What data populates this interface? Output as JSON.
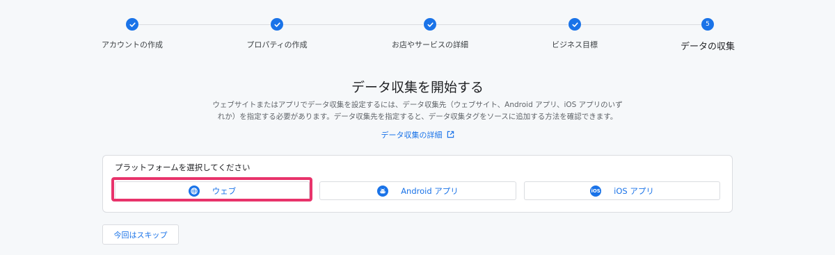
{
  "stepper": {
    "steps": [
      {
        "label": "アカウントの作成",
        "state": "done",
        "icon": "check-icon"
      },
      {
        "label": "プロパティの作成",
        "state": "done",
        "icon": "check-icon"
      },
      {
        "label": "お店やサービスの詳細",
        "state": "done",
        "icon": "check-icon"
      },
      {
        "label": "ビジネス目標",
        "state": "done",
        "icon": "check-icon"
      },
      {
        "label": "データの収集",
        "state": "active",
        "number": "5"
      }
    ]
  },
  "main": {
    "title": "データ収集を開始する",
    "desc_line1": "ウェブサイトまたはアプリでデータ収集を設定するには、データ収集先（ウェブサイト、Android アプリ、iOS アプリのいず",
    "desc_line2": "れか）を指定する必要があります。データ収集先を指定すると、データ収集タグをソースに追加する方法を確認できます。",
    "details_link": "データ収集の詳細"
  },
  "platform": {
    "title": "プラットフォームを選択してください",
    "options": [
      {
        "label": "ウェブ",
        "icon": "globe-icon"
      },
      {
        "label": "Android アプリ",
        "icon": "android-icon"
      },
      {
        "label": "iOS アプリ",
        "icon": "ios-icon",
        "icon_text": "iOS"
      }
    ]
  },
  "skip_label": "今回はスキップ",
  "colors": {
    "accent": "#1a73e8",
    "highlight": "#e8336b"
  }
}
